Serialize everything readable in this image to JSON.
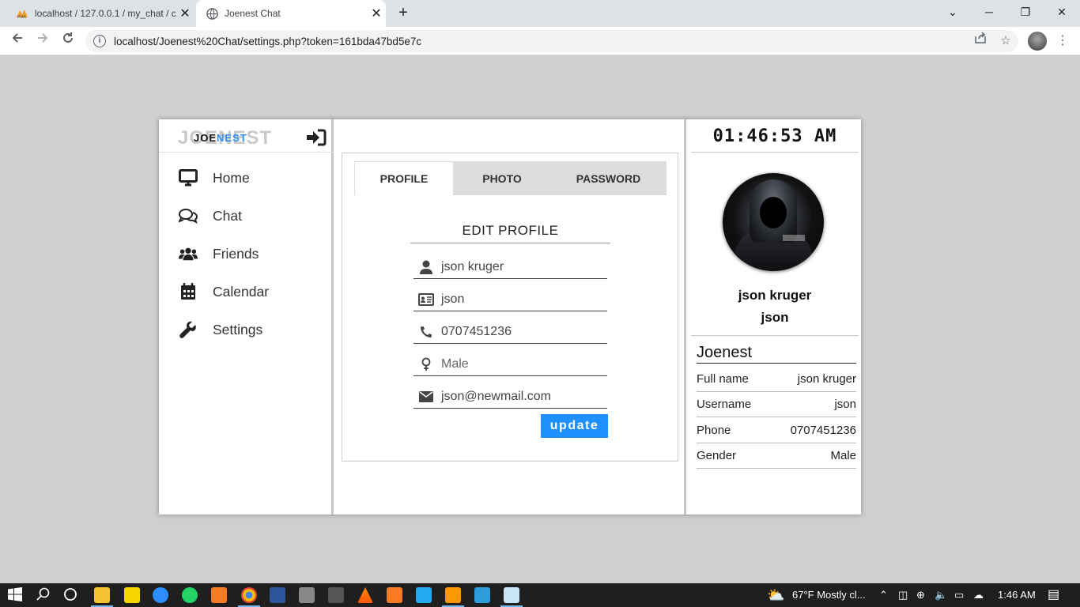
{
  "browser": {
    "tabs": [
      {
        "title": "localhost / 127.0.0.1 / my_chat / c",
        "favicon": "phpmyadmin-icon"
      },
      {
        "title": "Joenest Chat",
        "favicon": "globe-icon"
      }
    ],
    "url": "localhost/Joenest%20Chat/settings.php?token=161bda47bd5e7c"
  },
  "sidebar": {
    "logo_ghost": "JOENEST",
    "logo_main": "JOE",
    "logo_accent": "NEST",
    "items": [
      {
        "label": "Home",
        "icon": "monitor-icon"
      },
      {
        "label": "Chat",
        "icon": "comments-icon"
      },
      {
        "label": "Friends",
        "icon": "users-icon"
      },
      {
        "label": "Calendar",
        "icon": "calendar-icon"
      },
      {
        "label": "Settings",
        "icon": "wrench-icon"
      }
    ]
  },
  "settings": {
    "tabs": [
      "PROFILE",
      "PHOTO",
      "PASSWORD"
    ],
    "active_tab": "PROFILE",
    "form_title": "EDIT  PROFILE",
    "fields": {
      "fullname": "json kruger",
      "username": "json",
      "phone": "0707451236",
      "gender": "Male",
      "email": "json@newmail.com"
    },
    "update_label": "update"
  },
  "profile": {
    "clock": "01:46:53 AM",
    "name": "json kruger",
    "username": "json",
    "section_title": "Joenest",
    "details": [
      {
        "label": "Full name",
        "value": "json kruger"
      },
      {
        "label": "Username",
        "value": "json"
      },
      {
        "label": "Phone",
        "value": "0707451236"
      },
      {
        "label": "Gender",
        "value": "Male"
      }
    ]
  },
  "taskbar": {
    "weather": "67°F  Mostly cl...",
    "time": "1:46 AM"
  },
  "colors": {
    "accent": "#1e90ff",
    "logo_accent": "#2f8ff0",
    "background": "#cfcfcf"
  }
}
